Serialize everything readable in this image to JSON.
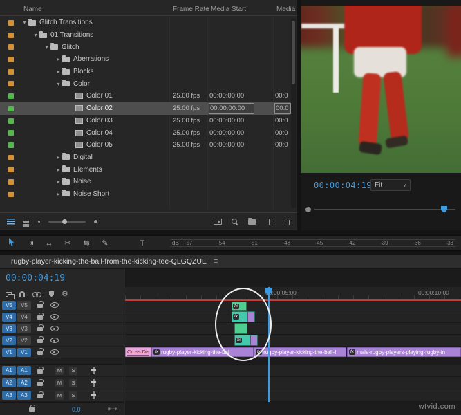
{
  "colors": {
    "accent_blue": "#3F9BE0",
    "clip_purple": "#A983D6",
    "clip_green": "#4FCF8F",
    "clip_teal": "#45C9AC",
    "transition_pink": "#E5A8DC",
    "render_red": "#C23C3C",
    "label_orange": "#D49136",
    "label_green": "#55B84F"
  },
  "icons": {
    "chevron_open": "▾",
    "chevron_closed": "▸",
    "sort_asc": "∧",
    "panel_menu": "≡",
    "dropdown": "∨",
    "track_select": "⇥",
    "ripple_edit": "↔",
    "razor": "✂",
    "slip": "⇆",
    "pen": "✎",
    "type": "T",
    "settings_gear": "⚙",
    "resize": "⇤⇥"
  },
  "project": {
    "columns": {
      "name": "Name",
      "frame_rate": "Frame Rate",
      "media_start": "Media Start",
      "media": "Media"
    },
    "rows": [
      {
        "name": "Glitch Transitions"
      },
      {
        "name": "01 Transitions"
      },
      {
        "name": "Glitch"
      },
      {
        "name": "Aberrations"
      },
      {
        "name": "Blocks"
      },
      {
        "name": "Color"
      },
      {
        "name": "Color 01",
        "frame_rate": "25.00 fps",
        "media_start": "00:00:00:00",
        "media": "00:0"
      },
      {
        "name": "Color 02",
        "frame_rate": "25.00 fps",
        "media_start": "00:00:00:00",
        "media": "00:0"
      },
      {
        "name": "Color 03",
        "frame_rate": "25.00 fps",
        "media_start": "00:00:00:00",
        "media": "00:0"
      },
      {
        "name": "Color 04",
        "frame_rate": "25.00 fps",
        "media_start": "00:00:00:00",
        "media": "00:0"
      },
      {
        "name": "Color 05",
        "frame_rate": "25.00 fps",
        "media_start": "00:00:00:00",
        "media": "00:0"
      },
      {
        "name": "Digital"
      },
      {
        "name": "Elements"
      },
      {
        "name": "Noise"
      },
      {
        "name": "Noise Short"
      }
    ]
  },
  "monitor": {
    "timecode": "00:00:04:19",
    "zoom_label": "Fit"
  },
  "meter": {
    "unit": "dB",
    "ticks": [
      "-57",
      "-54",
      "-51",
      "-48",
      "-45",
      "-42",
      "-39",
      "-36",
      "-33"
    ]
  },
  "timeline": {
    "tab_title": "rugby-player-kicking-the-ball-from-the-kicking-tee-QLGQZUE",
    "timecode": "00:00:04:19",
    "ruler": {
      "t5": "00:00:05:00",
      "t10": "00:00:10:00"
    },
    "video_tracks": [
      {
        "label": "V5"
      },
      {
        "label": "V4"
      },
      {
        "label": "V3"
      },
      {
        "label": "V2"
      },
      {
        "label": "V1"
      }
    ],
    "audio_tracks": [
      {
        "label": "A1"
      },
      {
        "label": "A2"
      },
      {
        "label": "A3"
      }
    ],
    "mute_label": "M",
    "solo_label": "S",
    "fx_badge": "fx",
    "clips": {
      "transition": "Cross Diss",
      "clip1": "rugby-player-kicking-the-bal",
      "clip2": "rugby-player-kicking-the-ball-f",
      "clip3": "male-rugby-players-playing-rugby-in"
    },
    "volume_readout": "0.0"
  },
  "watermark": "wtvid.com"
}
